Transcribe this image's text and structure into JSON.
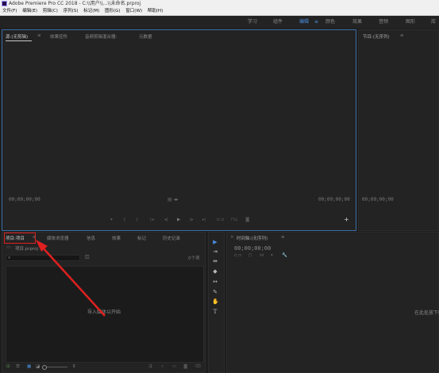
{
  "titlebar": {
    "title": "Adobe Premiere Pro CC 2018 - C:\\\\用户\\\\...\\\\未命名.prproj"
  },
  "menu": [
    "文件(F)",
    "编辑(E)",
    "剪辑(C)",
    "序列(S)",
    "标记(M)",
    "图形(G)",
    "窗口(W)",
    "帮助(H)"
  ],
  "workspaces": [
    "学习",
    "组件",
    "编辑",
    "颜色",
    "效果",
    "音频",
    "图形",
    "库"
  ],
  "source_panel": {
    "tabs": [
      "源:(无剪辑)",
      "效果控件",
      "音频剪辑混合器:",
      "元数据"
    ],
    "timecode_left": "00;00;00;00",
    "timecode_right": "00;00;00;00"
  },
  "program_panel": {
    "tab": "节目:(无序列)",
    "timecode_left": "00;00;00;00"
  },
  "project_panel": {
    "tabs": [
      "项目:项目",
      "媒体浏览器",
      "信息",
      "效果",
      "标记",
      "历史记录"
    ],
    "project_name": "项目.prproj",
    "item_count": "0个项",
    "empty_hint": "导入媒体以开始"
  },
  "timeline_panel": {
    "tab": "时间轴:(无序列)",
    "timecode": "00;00;00;00",
    "empty_hint": "在此处放下媒体"
  },
  "colors": {
    "accent": "#4a8fe0",
    "annotation": "#e02020"
  }
}
